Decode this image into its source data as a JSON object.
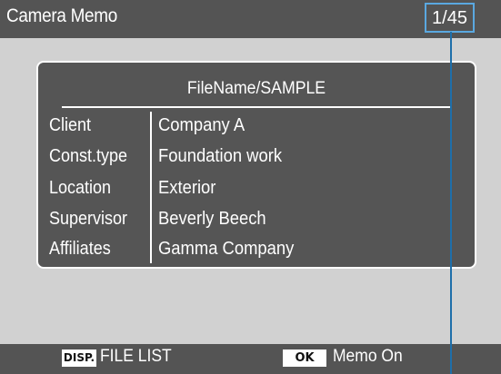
{
  "header": {
    "title": "Camera Memo",
    "counter": "1/45"
  },
  "memo": {
    "filename": "FileName/SAMPLE",
    "rows": [
      {
        "label": "Client",
        "value": "Company A"
      },
      {
        "label": "Const.type",
        "value": "Foundation work"
      },
      {
        "label": "Location",
        "value": "Exterior"
      },
      {
        "label": "Supervisor",
        "value": "Beverly Beech"
      },
      {
        "label": "Affiliates",
        "value": "Gamma Company"
      }
    ]
  },
  "footer": {
    "disp_badge": "DISP.",
    "disp_label": "FILE LIST",
    "ok_badge": "OK",
    "ok_label": "Memo On"
  },
  "colors": {
    "screen_bg": "#d1d1d1",
    "bar_bg": "#545454",
    "panel_bg": "#555555",
    "counter_border": "#5aa8e0",
    "callout_line": "#1e6faa"
  }
}
